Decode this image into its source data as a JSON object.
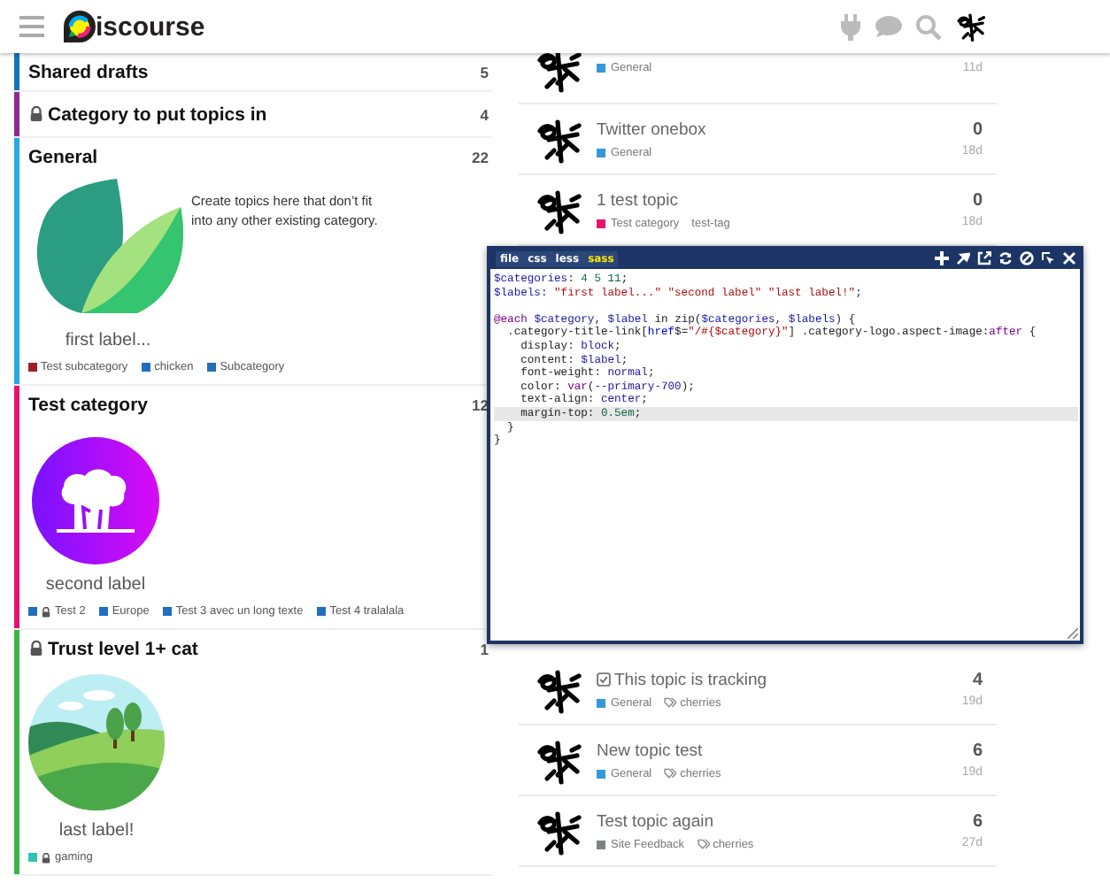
{
  "header": {
    "logo_text": "iscourse"
  },
  "categories": [
    {
      "name": "Shared drafts",
      "locked": false,
      "count": "5",
      "color": "#0e76bd"
    },
    {
      "name": "Category to put topics in",
      "locked": true,
      "count": "4",
      "color": "#92278f"
    },
    {
      "name": "General",
      "locked": false,
      "count": "22",
      "color": "#25aae1",
      "logo": {
        "kind": "leaf",
        "label": "first label..."
      },
      "description": "Create topics here that don’t fit into any other existing category.",
      "subcategories": [
        {
          "name": "Test subcategory",
          "locked": false,
          "color": "#9e1d2b"
        },
        {
          "name": "chicken",
          "locked": false,
          "color": "#1e6fbd"
        },
        {
          "name": "Subcategory",
          "locked": false,
          "color": "#1e6fbd"
        }
      ]
    },
    {
      "name": "Test category",
      "locked": false,
      "count": "12",
      "color": "#e6136e",
      "logo": {
        "kind": "tree",
        "label": "second label"
      },
      "subcategories": [
        {
          "name": "Test 2",
          "locked": true,
          "color": "#1e6fbd"
        },
        {
          "name": "Europe",
          "locked": false,
          "color": "#1e6fbd"
        },
        {
          "name": "Test 3 avec un long texte",
          "locked": false,
          "color": "#1e6fbd"
        },
        {
          "name": "Test 4 tralalala",
          "locked": false,
          "color": "#1e6fbd"
        }
      ]
    },
    {
      "name": "Trust level 1+ cat",
      "locked": true,
      "count": "1",
      "color": "#3ab54a",
      "logo": {
        "kind": "landscape",
        "label": "last label!"
      },
      "subcategories": [
        {
          "name": "gaming",
          "locked": true,
          "color": "#2ec4b6"
        }
      ]
    }
  ],
  "topics_top": [
    {
      "category": {
        "name": "General",
        "color": "#3498db"
      },
      "age": "11d"
    },
    {
      "title": "Twitter onebox",
      "tracking": false,
      "category": {
        "name": "General",
        "color": "#3498db"
      },
      "count": "0",
      "age": "18d"
    },
    {
      "title": "1 test topic",
      "tracking": false,
      "category": {
        "name": "Test category",
        "color": "#e6136e"
      },
      "tags": [
        {
          "name": "test-tag",
          "icon": false
        }
      ],
      "count": "0",
      "age": "18d"
    }
  ],
  "topics_bottom": [
    {
      "title": "This topic is tracking",
      "tracking": true,
      "category": {
        "name": "General",
        "color": "#3498db"
      },
      "tags": [
        {
          "name": "cherries",
          "icon": true
        }
      ],
      "count": "4",
      "age": "19d"
    },
    {
      "title": "New topic test",
      "tracking": false,
      "category": {
        "name": "General",
        "color": "#3498db"
      },
      "tags": [
        {
          "name": "cherries",
          "icon": true
        }
      ],
      "count": "6",
      "age": "19d"
    },
    {
      "title": "Test topic again",
      "tracking": false,
      "category": {
        "name": "Site Feedback",
        "color": "#808281"
      },
      "tags": [
        {
          "name": "cherries",
          "icon": true
        }
      ],
      "count": "6",
      "age": "27d"
    }
  ],
  "editor": {
    "tabs": [
      {
        "label": "file",
        "selected": false
      },
      {
        "label": "css",
        "selected": false
      },
      {
        "label": "less",
        "selected": false
      },
      {
        "label": "sass",
        "selected": true
      }
    ],
    "lines": [
      {
        "current": false,
        "segments": [
          {
            "kind": "var",
            "text": "$categories"
          },
          {
            "kind": "plain",
            "text": ": "
          },
          {
            "kind": "num",
            "text": "4 5 11"
          },
          {
            "kind": "plain",
            "text": ";"
          }
        ]
      },
      {
        "current": false,
        "segments": [
          {
            "kind": "var",
            "text": "$labels"
          },
          {
            "kind": "plain",
            "text": ": "
          },
          {
            "kind": "str",
            "text": "\"first label...\" \"second label\" \"last label!\""
          },
          {
            "kind": "plain",
            "text": ";"
          }
        ]
      },
      {
        "current": false
      },
      {
        "current": false,
        "segments": [
          {
            "kind": "kw",
            "text": "@each "
          },
          {
            "kind": "var",
            "text": "$category"
          },
          {
            "kind": "plain",
            "text": ", "
          },
          {
            "kind": "var",
            "text": "$label"
          },
          {
            "kind": "plain",
            "text": " in zip("
          },
          {
            "kind": "var",
            "text": "$categories"
          },
          {
            "kind": "plain",
            "text": ", "
          },
          {
            "kind": "var",
            "text": "$labels"
          },
          {
            "kind": "plain",
            "text": ") {"
          }
        ]
      },
      {
        "current": false,
        "segments": [
          {
            "kind": "plain",
            "text": "  .category-title-link["
          },
          {
            "kind": "attr",
            "text": "href"
          },
          {
            "kind": "plain",
            "text": "$="
          },
          {
            "kind": "str",
            "text": "\"/#{$category}\""
          },
          {
            "kind": "plain",
            "text": "] .category-logo.aspect-image:"
          },
          {
            "kind": "kw",
            "text": "after"
          },
          {
            "kind": "plain",
            "text": " {"
          }
        ]
      },
      {
        "current": false,
        "segments": [
          {
            "kind": "prop",
            "text": "    display"
          },
          {
            "kind": "plain",
            "text": ": "
          },
          {
            "kind": "atom",
            "text": "block"
          },
          {
            "kind": "plain",
            "text": ";"
          }
        ]
      },
      {
        "current": false,
        "segments": [
          {
            "kind": "prop",
            "text": "    content"
          },
          {
            "kind": "plain",
            "text": ": "
          },
          {
            "kind": "var",
            "text": "$label"
          },
          {
            "kind": "plain",
            "text": ";"
          }
        ]
      },
      {
        "current": false,
        "segments": [
          {
            "kind": "prop",
            "text": "    font-weight"
          },
          {
            "kind": "plain",
            "text": ": "
          },
          {
            "kind": "atom",
            "text": "normal"
          },
          {
            "kind": "plain",
            "text": ";"
          }
        ]
      },
      {
        "current": false,
        "segments": [
          {
            "kind": "prop",
            "text": "    color"
          },
          {
            "kind": "plain",
            "text": ": "
          },
          {
            "kind": "kw",
            "text": "var"
          },
          {
            "kind": "plain",
            "text": "("
          },
          {
            "kind": "atom",
            "text": "--primary-700"
          },
          {
            "kind": "plain",
            "text": ");"
          }
        ]
      },
      {
        "current": false,
        "segments": [
          {
            "kind": "prop",
            "text": "    text-align"
          },
          {
            "kind": "plain",
            "text": ": "
          },
          {
            "kind": "atom",
            "text": "center"
          },
          {
            "kind": "plain",
            "text": ";"
          }
        ]
      },
      {
        "current": true,
        "segments": [
          {
            "kind": "prop",
            "text": "    margin-top"
          },
          {
            "kind": "plain",
            "text": ": "
          },
          {
            "kind": "num",
            "text": "0.5em"
          },
          {
            "kind": "plain",
            "text": ";"
          }
        ]
      },
      {
        "current": false,
        "segments": [
          {
            "kind": "plain",
            "text": "  }"
          }
        ]
      },
      {
        "current": false,
        "segments": [
          {
            "kind": "plain",
            "text": "}"
          }
        ]
      }
    ]
  }
}
